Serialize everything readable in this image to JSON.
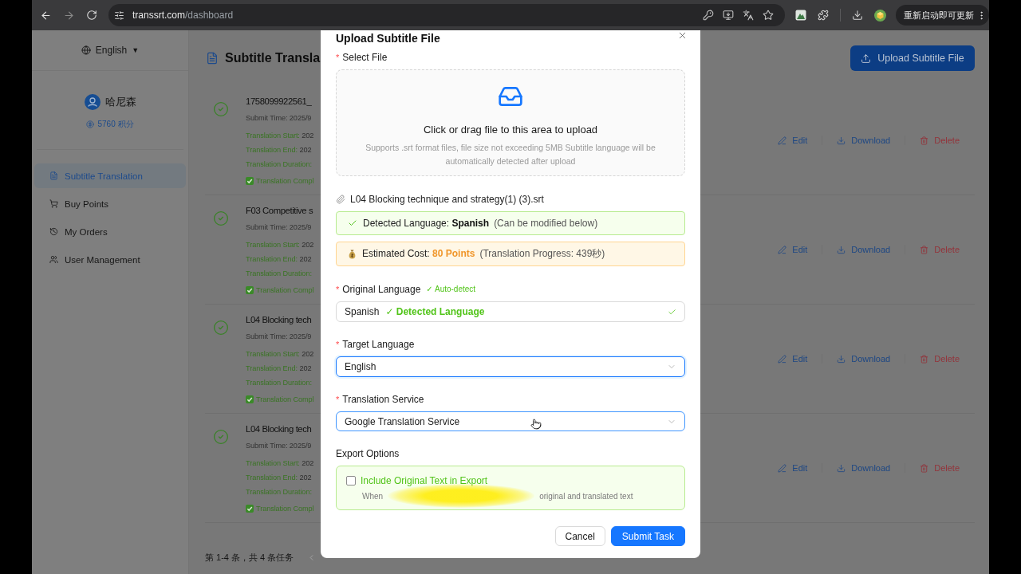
{
  "browser": {
    "url": {
      "host": "transsrt.com",
      "path": "/dashboard"
    },
    "update_button": "重新启动即可更新"
  },
  "sidebar": {
    "language": {
      "label": "English",
      "caret": "▼"
    },
    "user": {
      "name": "哈尼森",
      "points": "5760 积分"
    },
    "items": [
      {
        "label": "Subtitle Translation",
        "selected": true
      },
      {
        "label": "Buy Points",
        "selected": false
      },
      {
        "label": "My Orders",
        "selected": false
      },
      {
        "label": "User Management",
        "selected": false
      }
    ]
  },
  "main": {
    "title": "Subtitle Transla",
    "upload_button": "Upload Subtitle File",
    "tasks": [
      {
        "title": "1758099922561_",
        "submit_time": "Submit Time: 2025/9",
        "start_label": "Translation Start:",
        "start_value": "202",
        "end_label": "Translation End:",
        "end_value": "202",
        "duration_label": "Translation Duration:",
        "status": "Translation Compl",
        "actions": [
          {
            "kind": "edit",
            "label": "Edit"
          },
          {
            "kind": "download",
            "label": "Download"
          },
          {
            "kind": "delete",
            "label": "Delete"
          }
        ]
      },
      {
        "title": "F03 Competitive s",
        "submit_time": "Submit Time: 2025/9",
        "start_label": "Translation Start:",
        "start_value": "202",
        "end_label": "Translation End:",
        "end_value": "202",
        "duration_label": "Translation Duration:",
        "status": "Translation Compl",
        "actions": [
          {
            "kind": "edit",
            "label": "Edit"
          },
          {
            "kind": "download",
            "label": "Download"
          },
          {
            "kind": "delete",
            "label": "Delete"
          }
        ]
      },
      {
        "title": "L04 Blocking tech",
        "submit_time": "Submit Time: 2025/9",
        "start_label": "Translation Start:",
        "start_value": "202",
        "end_label": "Translation End:",
        "end_value": "202",
        "duration_label": "Translation Duration:",
        "status": "Translation Compl",
        "actions": [
          {
            "kind": "edit",
            "label": "Edit"
          },
          {
            "kind": "download",
            "label": "Download"
          },
          {
            "kind": "delete",
            "label": "Delete"
          }
        ]
      },
      {
        "title": "L04 Blocking tech",
        "submit_time": "Submit Time: 2025/9",
        "start_label": "Translation Start:",
        "start_value": "202",
        "end_label": "Translation End:",
        "end_value": "202",
        "duration_label": "Translation Duration:",
        "status": "Translation Compl",
        "actions": [
          {
            "kind": "edit",
            "label": "Edit"
          },
          {
            "kind": "download",
            "label": "Download"
          },
          {
            "kind": "delete",
            "label": "Delete"
          }
        ]
      }
    ],
    "pagination": {
      "summary": "第 1-4 条，共 4 条任务"
    }
  },
  "modal": {
    "title": "Upload Subtitle File",
    "upload": {
      "required_mark": "*",
      "label": "Select File",
      "prompt": "Click or drag file to this area to upload",
      "hint": "Supports .srt format files, file size not exceeding 5MB Subtitle language will be automatically detected after upload"
    },
    "file_name": "L04 Blocking technique and strategy(1) (3).srt",
    "alerts": [
      {
        "kind": "success",
        "label": "Detected Language:",
        "highlight": "Spanish",
        "note": "(Can be modified below)"
      },
      {
        "kind": "cost",
        "label": "Estimated Cost:",
        "highlight": "80 Points",
        "note": "(Translation Progress: 439秒)"
      }
    ],
    "selects": [
      {
        "kind": "detected",
        "required_mark": "*",
        "label": "Original Language",
        "hint": "✓ Auto-detect",
        "value": "Spanish",
        "badge": "✓ Detected Language",
        "focused": false,
        "hovered": false
      },
      {
        "kind": "dropdown",
        "required_mark": "*",
        "label": "Target Language",
        "value": "English",
        "focused": true,
        "hovered": false
      },
      {
        "kind": "dropdown",
        "required_mark": "*",
        "label": "Translation Service",
        "value": "Google Translation Service",
        "focused": false,
        "hovered": true
      }
    ],
    "export": {
      "label": "Export Options",
      "checkbox": {
        "label": "Include Original Text in Export",
        "checked": false
      },
      "description_start": "When",
      "description_end": "original and translated text"
    },
    "buttons": [
      {
        "kind": "default",
        "label": "Cancel"
      },
      {
        "kind": "primary",
        "label": "Submit Task"
      }
    ]
  }
}
